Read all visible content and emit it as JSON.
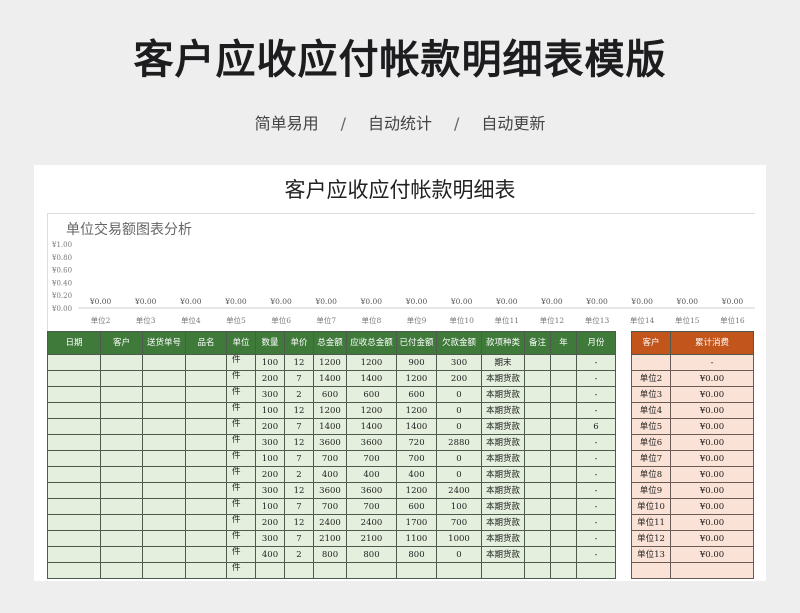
{
  "header": {
    "main_title": "客户应收应付帐款明细表模版",
    "subtitle_items": [
      "简单易用",
      "自动统计",
      "自动更新"
    ],
    "subtitle_separator": "/"
  },
  "sheet": {
    "title": "客户应收应付帐款明细表"
  },
  "chart_data": {
    "type": "bar",
    "title": "单位交易额图表分析",
    "categories": [
      "单位2",
      "单位3",
      "单位4",
      "单位5",
      "单位6",
      "单位7",
      "单位8",
      "单位9",
      "单位10",
      "单位11",
      "单位12",
      "单位13",
      "单位14",
      "单位15",
      "单位16"
    ],
    "values": [
      0,
      0,
      0,
      0,
      0,
      0,
      0,
      0,
      0,
      0,
      0,
      0,
      0,
      0,
      0
    ],
    "data_labels": [
      "¥0.00",
      "¥0.00",
      "¥0.00",
      "¥0.00",
      "¥0.00",
      "¥0.00",
      "¥0.00",
      "¥0.00",
      "¥0.00",
      "¥0.00",
      "¥0.00",
      "¥0.00",
      "¥0.00",
      "¥0.00",
      "¥0.00"
    ],
    "y_ticks": [
      "¥1.00",
      "¥0.80",
      "¥0.60",
      "¥0.40",
      "¥0.20",
      "¥0.00"
    ],
    "ylim": [
      0,
      1
    ]
  },
  "table": {
    "headers": [
      "日期",
      "客户",
      "送货单号",
      "品名",
      "单位",
      "数量",
      "单价",
      "总金额",
      "应收总金额",
      "已付金额",
      "欠款金额",
      "款项种类",
      "备注",
      "年",
      "月份"
    ],
    "rows": [
      [
        "",
        "",
        "",
        "",
        "件",
        "100",
        "12",
        "1200",
        "1200",
        "900",
        "300",
        "期末",
        "",
        "",
        "-"
      ],
      [
        "",
        "",
        "",
        "",
        "件",
        "200",
        "7",
        "1400",
        "1400",
        "1200",
        "200",
        "本期货款",
        "",
        "",
        "-"
      ],
      [
        "",
        "",
        "",
        "",
        "件",
        "300",
        "2",
        "600",
        "600",
        "600",
        "0",
        "本期货款",
        "",
        "",
        "-"
      ],
      [
        "",
        "",
        "",
        "",
        "件",
        "100",
        "12",
        "1200",
        "1200",
        "1200",
        "0",
        "本期货款",
        "",
        "",
        "-"
      ],
      [
        "",
        "",
        "",
        "",
        "件",
        "200",
        "7",
        "1400",
        "1400",
        "1400",
        "0",
        "本期货款",
        "",
        "",
        "6"
      ],
      [
        "",
        "",
        "",
        "",
        "件",
        "300",
        "12",
        "3600",
        "3600",
        "720",
        "2880",
        "本期货款",
        "",
        "",
        "-"
      ],
      [
        "",
        "",
        "",
        "",
        "件",
        "100",
        "7",
        "700",
        "700",
        "700",
        "0",
        "本期货款",
        "",
        "",
        "-"
      ],
      [
        "",
        "",
        "",
        "",
        "件",
        "200",
        "2",
        "400",
        "400",
        "400",
        "0",
        "本期货款",
        "",
        "",
        "-"
      ],
      [
        "",
        "",
        "",
        "",
        "件",
        "300",
        "12",
        "3600",
        "3600",
        "1200",
        "2400",
        "本期货款",
        "",
        "",
        "-"
      ],
      [
        "",
        "",
        "",
        "",
        "件",
        "100",
        "7",
        "700",
        "700",
        "600",
        "100",
        "本期货款",
        "",
        "",
        "-"
      ],
      [
        "",
        "",
        "",
        "",
        "件",
        "200",
        "12",
        "2400",
        "2400",
        "1700",
        "700",
        "本期货款",
        "",
        "",
        "-"
      ],
      [
        "",
        "",
        "",
        "",
        "件",
        "300",
        "7",
        "2100",
        "2100",
        "1100",
        "1000",
        "本期货款",
        "",
        "",
        "-"
      ],
      [
        "",
        "",
        "",
        "",
        "件",
        "400",
        "2",
        "800",
        "800",
        "800",
        "0",
        "本期货款",
        "",
        "",
        "-"
      ],
      [
        "",
        "",
        "",
        "",
        "件",
        "",
        "",
        "",
        "",
        "",
        "",
        "",
        "",
        "",
        ""
      ]
    ]
  },
  "summary": {
    "headers": [
      "客户",
      "累计消费"
    ],
    "rows": [
      [
        "",
        "-"
      ],
      [
        "单位2",
        "¥0.00"
      ],
      [
        "单位3",
        "¥0.00"
      ],
      [
        "单位4",
        "¥0.00"
      ],
      [
        "单位5",
        "¥0.00"
      ],
      [
        "单位6",
        "¥0.00"
      ],
      [
        "单位7",
        "¥0.00"
      ],
      [
        "单位8",
        "¥0.00"
      ],
      [
        "单位9",
        "¥0.00"
      ],
      [
        "单位10",
        "¥0.00"
      ],
      [
        "单位11",
        "¥0.00"
      ],
      [
        "单位12",
        "¥0.00"
      ],
      [
        "单位13",
        "¥0.00"
      ],
      [
        "",
        ""
      ]
    ]
  },
  "colors": {
    "table_header": "#3f7a3b",
    "table_body": "#e4efde",
    "summary_header": "#c2551b",
    "summary_body": "#fbe2d6"
  }
}
